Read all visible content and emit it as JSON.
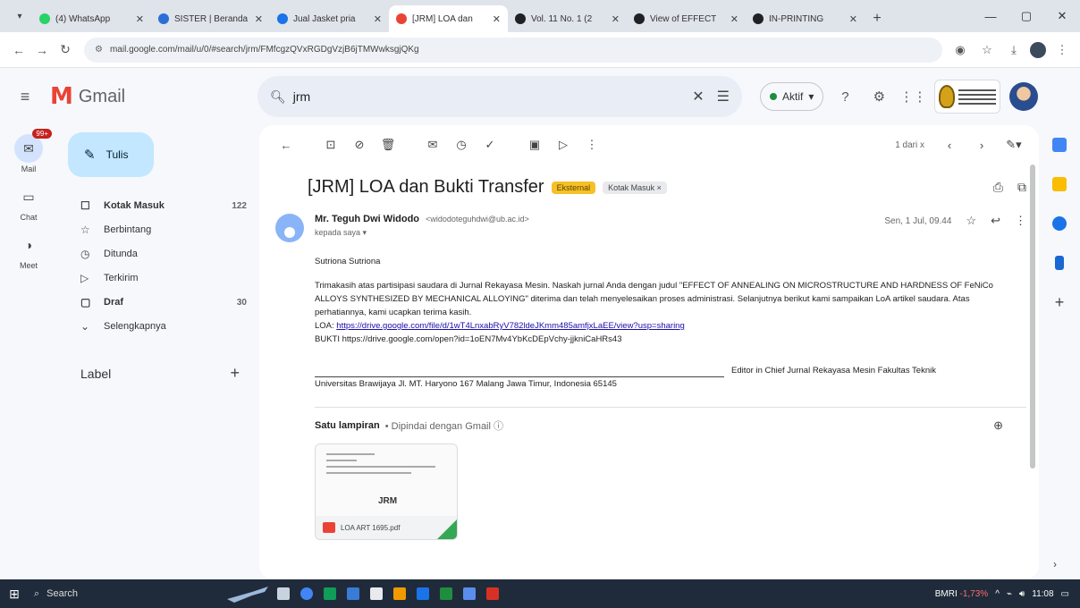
{
  "browser": {
    "tabs": [
      {
        "title": "(4) WhatsApp",
        "color": "#25d366"
      },
      {
        "title": "SISTER | Beranda",
        "color": "#2a6fd6"
      },
      {
        "title": "Jual Jasket pria",
        "color": "#1a73e8"
      },
      {
        "title": "[JRM] LOA dan",
        "color": "#ea4335"
      },
      {
        "title": "Vol. 11 No. 1 (2",
        "color": "#202124"
      },
      {
        "title": "View of EFFECT",
        "color": "#202124"
      },
      {
        "title": "IN-PRINTING",
        "color": "#202124"
      }
    ],
    "active_tab_index": 3,
    "new_tab": "+",
    "window_controls": [
      "—",
      "▢",
      "✕"
    ],
    "url": "mail.google.com/mail/u/0/#search/jrm/FMfcgzQVxRGDgVzjB6jTMWwksgjQKg"
  },
  "gmail": {
    "logo_text": "Gmail",
    "search_value": "jrm",
    "status": "Aktif",
    "rail": [
      {
        "label": "Mail",
        "icon": "mail-icon",
        "badge": "99+"
      },
      {
        "label": "Chat",
        "icon": "chat-icon"
      },
      {
        "label": "Meet",
        "icon": "meet-icon"
      }
    ],
    "compose_label": "Tulis",
    "nav": [
      {
        "label": "Kotak Masuk",
        "icon": "☐",
        "count": "122",
        "bold": true
      },
      {
        "label": "Berbintang",
        "icon": "☆",
        "count": ""
      },
      {
        "label": "Ditunda",
        "icon": "◷",
        "count": ""
      },
      {
        "label": "Terkirim",
        "icon": "▷",
        "count": ""
      },
      {
        "label": "Draf",
        "icon": "▢",
        "count": "30",
        "bold": true
      },
      {
        "label": "Selengkapnya",
        "icon": "⌄",
        "count": ""
      }
    ],
    "label_header": "Label",
    "pager": "1 dari x"
  },
  "email": {
    "subject": "[JRM] LOA dan Bukti Transfer",
    "chip_external": "Eksternal",
    "chip_inbox": "Kotak Masuk ×",
    "sender_name": "Mr. Teguh Dwi Widodo",
    "sender_email": "<widodoteguhdwi@ub.ac.id>",
    "to": "kepada saya ▾",
    "date": "Sen, 1 Jul, 09.44",
    "greeting": "Sutriona Sutriona",
    "para1": "Trimakasih atas partisipasi saudara di Jurnal Rekayasa Mesin. Naskah jurnal Anda dengan judul \"EFFECT OF ANNEALING ON MICROSTRUCTURE AND HARDNESS OF FeNiCo ALLOYS SYNTHESIZED BY MECHANICAL ALLOYING\" diterima dan telah menyelesaikan proses administrasi. Selanjutnya berikut kami sampaikan LoA artikel saudara. Atas perhatiannya, kami ucapkan terima kasih.",
    "loa_prefix": "LOA:",
    "loa_link": "https://drive.google.com/file/d/1wT4LnxabRyV782ldeJKmm485amfjxLaEE/view?usp=sharing",
    "bukti": "BUKTI https://drive.google.com/open?id=1oEN7Mv4YbKcDEpVchy-jjkniCaHRs43",
    "sig_right": "Editor in Chief Jurnal Rekayasa Mesin Fakultas Teknik",
    "sig_address": "Universitas Brawijaya Jl. MT. Haryono 167 Malang Jawa Timur, Indonesia 65145",
    "attach_title": "Satu lampiran",
    "attach_scan": "• Dipindai dengan Gmail ⓘ",
    "attach_logo": "JRM",
    "attach_file": "LOA ART 1695.pdf"
  },
  "taskbar": {
    "search": "Search",
    "stock_name": "BMRI",
    "stock_change": "-1,73%",
    "time": "11:08"
  }
}
